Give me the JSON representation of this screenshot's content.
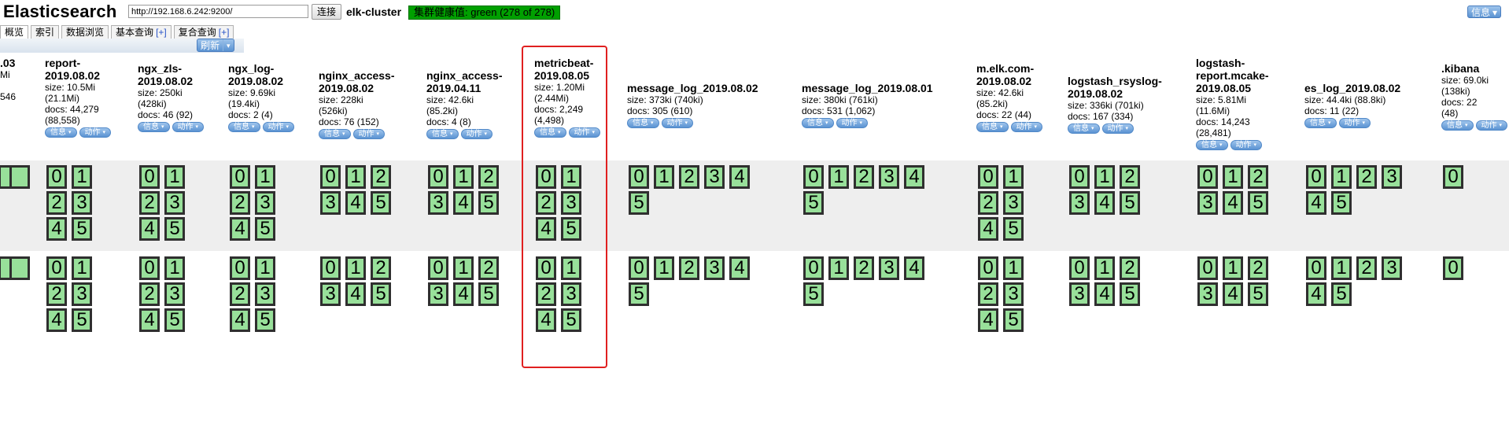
{
  "header": {
    "app_title": "Elasticsearch",
    "url_value": "http://192.168.6.242:9200/",
    "connect_label": "连接",
    "cluster_name": "elk-cluster",
    "health_text": "集群健康值: green (278 of 278)",
    "info_label": "信息",
    "info_caret": "▾"
  },
  "tabs": [
    {
      "label": "概览",
      "plus": ""
    },
    {
      "label": "索引",
      "plus": ""
    },
    {
      "label": "数据浏览",
      "plus": ""
    },
    {
      "label": "基本查询",
      "plus": "[+]"
    },
    {
      "label": "复合查询",
      "plus": "[+]"
    }
  ],
  "refresh": {
    "label": "刷新",
    "caret": "▾"
  },
  "colors": {
    "shard_fill": "#98e09a",
    "health_green": "#00a000",
    "button_blue": "#5b93d2",
    "highlight": "#e02020"
  },
  "button_labels": {
    "info": "信息",
    "action": "动作",
    "caret": "▾"
  },
  "indices": [
    {
      "name": ".03",
      "stats": "Mi\n\n546",
      "shards": []
    },
    {
      "name": "report-\n2019.08.02",
      "stats": "size: 10.5Mi\n(21.1Mi)\ndocs: 44,279\n(88,558)",
      "shards": [
        "0",
        "1",
        "2",
        "3",
        "4",
        "5"
      ]
    },
    {
      "name": "ngx_zls-\n2019.08.02",
      "stats": "size: 250ki\n(428ki)\ndocs: 46 (92)",
      "shards": [
        "0",
        "1",
        "2",
        "3",
        "4",
        "5"
      ]
    },
    {
      "name": "ngx_log-\n2019.08.02",
      "stats": "size: 9.69ki\n(19.4ki)\ndocs: 2 (4)",
      "shards": [
        "0",
        "1",
        "2",
        "3",
        "4",
        "5"
      ]
    },
    {
      "name": "nginx_access-\n2019.08.02",
      "stats": "size: 228ki\n(526ki)\ndocs: 76 (152)",
      "shards": [
        "0",
        "1",
        "2",
        "3",
        "4",
        "5"
      ]
    },
    {
      "name": "nginx_access-\n2019.04.11",
      "stats": "size: 42.6ki\n(85.2ki)\ndocs: 4 (8)",
      "shards": [
        "0",
        "1",
        "2",
        "3",
        "4",
        "5"
      ]
    },
    {
      "name": "metricbeat-\n2019.08.05",
      "stats": "size: 1.20Mi\n(2.44Mi)\ndocs: 2,249\n(4,498)",
      "shards": [
        "0",
        "1",
        "2",
        "3",
        "4",
        "5"
      ]
    },
    {
      "name": "message_log_2019.08.02",
      "stats": "size: 373ki (740ki)\ndocs: 305 (610)",
      "shards": [
        "0",
        "1",
        "2",
        "3",
        "4",
        "5"
      ]
    },
    {
      "name": "message_log_2019.08.01",
      "stats": "size: 380ki (761ki)\ndocs: 531 (1,062)",
      "shards": [
        "0",
        "1",
        "2",
        "3",
        "4",
        "5"
      ]
    },
    {
      "name": "m.elk.com-\n2019.08.02",
      "stats": "size: 42.6ki\n(85.2ki)\ndocs: 22 (44)",
      "shards": [
        "0",
        "1",
        "2",
        "3",
        "4",
        "5"
      ]
    },
    {
      "name": "logstash_rsyslog-\n2019.08.02",
      "stats": "size: 336ki (701ki)\ndocs: 167 (334)",
      "shards": [
        "0",
        "1",
        "2",
        "3",
        "4",
        "5"
      ]
    },
    {
      "name": "logstash-\nreport.mcake-\n2019.08.05",
      "stats": "size: 5.81Mi\n(11.6Mi)\ndocs: 14,243\n(28,481)",
      "shards": [
        "0",
        "1",
        "2",
        "3",
        "4",
        "5"
      ]
    },
    {
      "name": "es_log_2019.08.02",
      "stats": "size: 44.4ki (88.8ki)\ndocs: 11 (22)",
      "shards": [
        "0",
        "1",
        "2",
        "3",
        "4",
        "5"
      ]
    },
    {
      "name": ".kibana",
      "stats": "size: 69.0ki\n(138ki)\ndocs: 22\n(48)",
      "shards": [
        "0"
      ]
    }
  ]
}
